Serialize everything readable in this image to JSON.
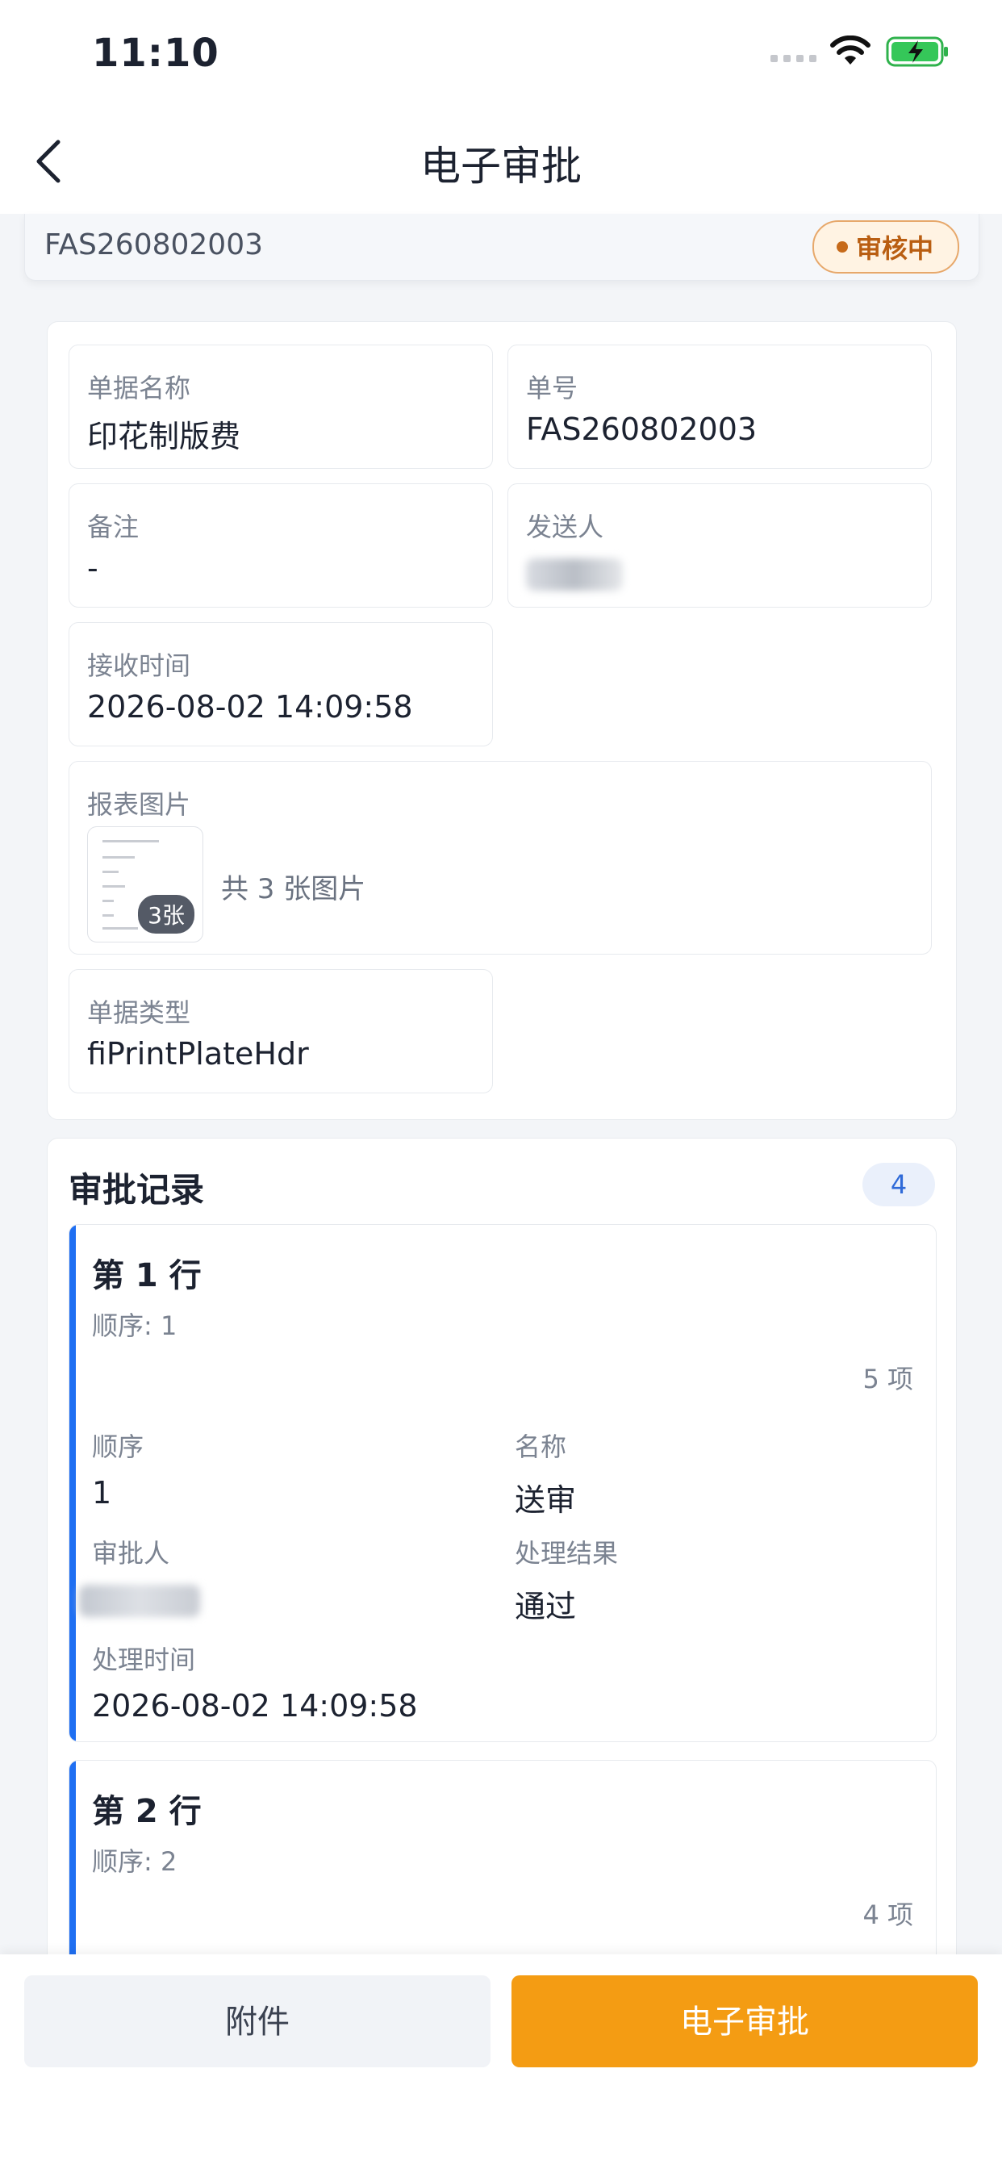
{
  "status_bar": {
    "time": "11:10"
  },
  "nav": {
    "title": "电子审批"
  },
  "header_card": {
    "doc_no": "FAS260802003",
    "status": "审核中"
  },
  "details": {
    "doc_name_label": "单据名称",
    "doc_name": "印花制版费",
    "doc_no_label": "单号",
    "doc_no": "FAS260802003",
    "remark_label": "备注",
    "remark": "-",
    "sender_label": "发送人",
    "received_label": "接收时间",
    "received_time": "2026-08-02 14:09:58",
    "images_label": "报表图片",
    "image_count_badge": "3张",
    "image_count_text": "共 3 张图片",
    "doc_type_label": "单据类型",
    "doc_type": "fiPrintPlateHdr"
  },
  "records": {
    "title": "审批记录",
    "count": "4",
    "rows": [
      {
        "title": "第 1 行",
        "subtitle": "顺序: 1",
        "items": "5 项",
        "order_label": "顺序",
        "order": "1",
        "name_label": "名称",
        "name": "送审",
        "approver_label": "审批人",
        "result_label": "处理结果",
        "result": "通过",
        "time_label": "处理时间",
        "time": "2026-08-02 14:09:58"
      },
      {
        "title": "第 2 行",
        "subtitle": "顺序: 2",
        "items": "4 项"
      }
    ]
  },
  "actions": {
    "attach": "附件",
    "approve": "电子审批"
  }
}
